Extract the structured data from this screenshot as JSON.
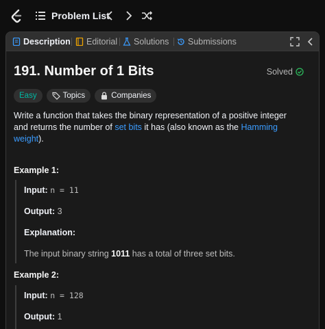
{
  "topbar": {
    "problem_list": "Problem List"
  },
  "tabs": [
    {
      "label": "Description"
    },
    {
      "label": "Editorial"
    },
    {
      "label": "Solutions"
    },
    {
      "label": "Submissions"
    }
  ],
  "problem": {
    "title": "191. Number of 1 Bits",
    "status": "Solved",
    "difficulty": "Easy",
    "topics_label": "Topics",
    "companies_label": "Companies",
    "desc_part1": "Write a function that takes the binary representation of a positive integer and returns the number of ",
    "desc_link1": "set bits",
    "desc_part2": " it has (also known as the ",
    "desc_link2": "Hamming weight",
    "desc_part3": ")."
  },
  "examples": [
    {
      "title": "Example 1:",
      "input_label": "Input:",
      "input_value": "n = 11",
      "output_label": "Output:",
      "output_value": "3",
      "explanation_label": "Explanation:",
      "explanation_pre": "The input binary string ",
      "explanation_bold": "1011",
      "explanation_post": " has a total of three set bits."
    },
    {
      "title": "Example 2:",
      "input_label": "Input:",
      "input_value": "n = 128",
      "output_label": "Output:",
      "output_value": "1"
    }
  ],
  "colors": {
    "accent_link": "#3b9cff",
    "easy": "#00b8a3",
    "solved_check": "#2cbb5d"
  }
}
